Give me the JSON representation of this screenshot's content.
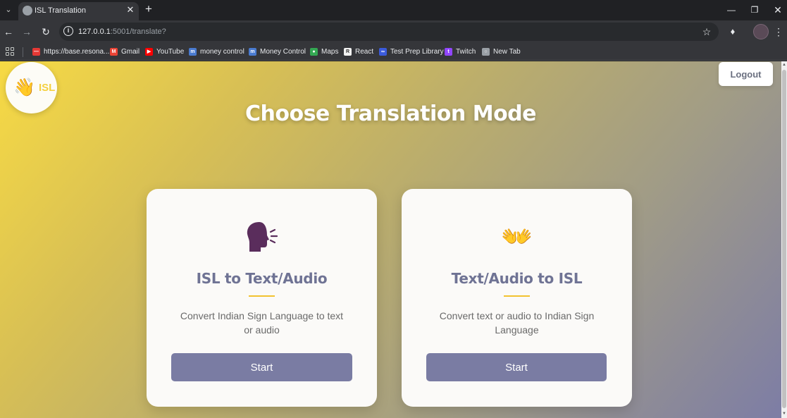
{
  "browser": {
    "tab_title": "ISL Translation",
    "url_host": "127.0.0.1",
    "url_path": ":5001/translate?",
    "bookmarks": [
      {
        "label": "https://base.resona...",
        "icon": "resonance-icon",
        "color": "#e53935"
      },
      {
        "label": "Gmail",
        "icon": "gmail-icon",
        "color": "#ea4335"
      },
      {
        "label": "YouTube",
        "icon": "youtube-icon",
        "color": "#ff0000"
      },
      {
        "label": "money control",
        "icon": "moneycontrol-icon",
        "color": "#4a7bd0"
      },
      {
        "label": "Money Control",
        "icon": "moneycontrol-icon",
        "color": "#4a7bd0"
      },
      {
        "label": "Maps",
        "icon": "maps-icon",
        "color": "#34a853"
      },
      {
        "label": "React",
        "icon": "react-icon",
        "color": "#f2f2f2"
      },
      {
        "label": "Test Prep Library",
        "icon": "testprep-icon",
        "color": "#3b5bdb"
      },
      {
        "label": "Twitch",
        "icon": "twitch-icon",
        "color": "#9146ff"
      },
      {
        "label": "New Tab",
        "icon": "globe-icon",
        "color": "#9aa0a6"
      }
    ]
  },
  "header": {
    "logo_text": "ISL",
    "logo_icon": "waving-hand-icon",
    "logout_label": "Logout"
  },
  "main": {
    "title": "Choose Translation Mode",
    "cards": [
      {
        "icon": "speaking-head-icon",
        "title": "ISL to Text/Audio",
        "description": "Convert Indian Sign Language to text or audio",
        "button_label": "Start"
      },
      {
        "icon": "open-hands-icon",
        "title": "Text/Audio to ISL",
        "description": "Convert text or audio to Indian Sign Language",
        "button_label": "Start"
      }
    ]
  },
  "colors": {
    "accent": "#7a7ca3",
    "underline": "#f2c230",
    "title_text": "#6f7394"
  }
}
